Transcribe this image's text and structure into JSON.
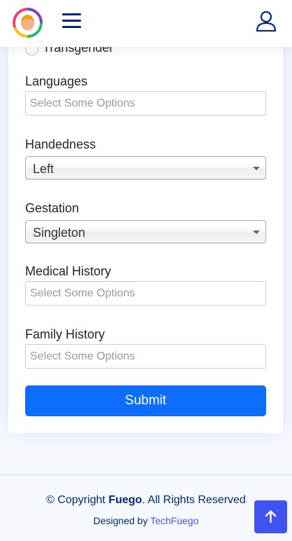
{
  "header": {
    "logo_icon": "fuego-logo-icon",
    "menu_icon": "hamburger-menu-icon",
    "profile_icon": "user-profile-icon"
  },
  "form": {
    "gender_option": "Transgender",
    "languages": {
      "label": "Languages",
      "placeholder": "Select Some Options"
    },
    "handedness": {
      "label": "Handedness",
      "value": "Left"
    },
    "gestation": {
      "label": "Gestation",
      "value": "Singleton"
    },
    "medical_history": {
      "label": "Medical History",
      "placeholder": "Select Some Options"
    },
    "family_history": {
      "label": "Family History",
      "placeholder": "Select Some Options"
    },
    "submit_label": "Submit"
  },
  "footer": {
    "copyright_prefix": "© Copyright ",
    "brand": "Fuego",
    "copyright_suffix": ". All Rights Reserved",
    "designed_by": "Designed by ",
    "designer": "TechFuego"
  },
  "colors": {
    "primary": "#0d6efd",
    "accent": "#4154f1",
    "navy": "#012970",
    "background": "#f6f9ff"
  }
}
